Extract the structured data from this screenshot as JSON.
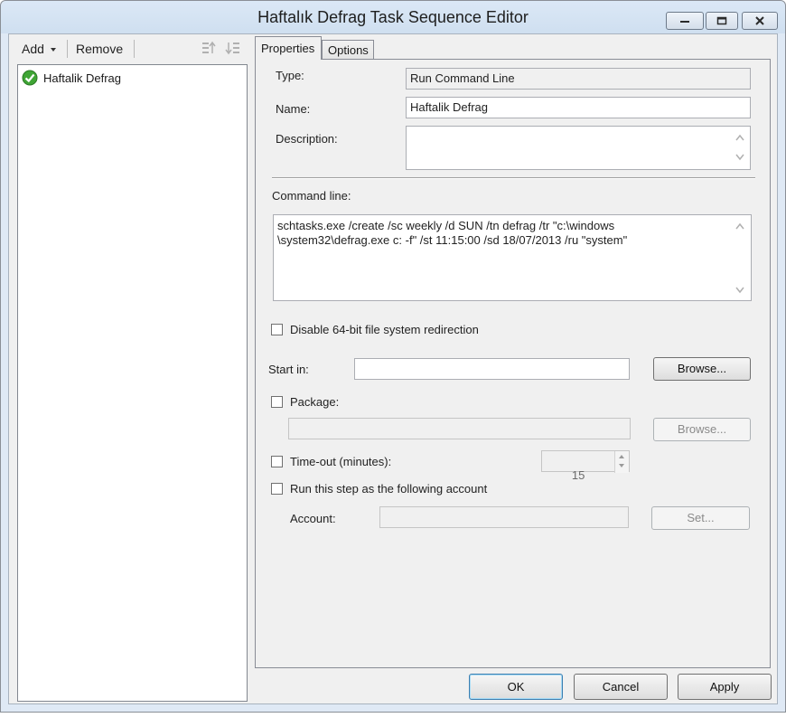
{
  "window": {
    "title": "Haftalık Defrag Task Sequence Editor"
  },
  "toolbar": {
    "add_label": "Add",
    "remove_label": "Remove"
  },
  "tree": {
    "items": [
      {
        "label": "Haftalik Defrag",
        "icon": "green-check-icon"
      }
    ]
  },
  "tabs": [
    {
      "label": "Properties",
      "active": true
    },
    {
      "label": "Options",
      "active": false
    }
  ],
  "properties": {
    "type_label": "Type:",
    "type_value": "Run Command Line",
    "name_label": "Name:",
    "name_value": "Haftalik Defrag",
    "description_label": "Description:",
    "description_value": "",
    "command_line_label": "Command line:",
    "command_line_value": "schtasks.exe /create /sc weekly /d SUN /tn defrag /tr \"c:\\windows\n\\system32\\defrag.exe c: -f\" /st 11:15:00 /sd 18/07/2013 /ru \"system\"",
    "disable_redirection_label": "Disable 64-bit file system redirection",
    "disable_redirection_checked": false,
    "start_in_label": "Start in:",
    "start_in_value": "",
    "browse_label": "Browse...",
    "package_label": "Package:",
    "package_checked": false,
    "package_value": "",
    "package_browse_label": "Browse...",
    "timeout_label": "Time-out (minutes):",
    "timeout_checked": false,
    "timeout_value": "15",
    "run_as_label": "Run this step as the following account",
    "run_as_checked": false,
    "account_label": "Account:",
    "account_value": "",
    "set_label": "Set..."
  },
  "footer": {
    "ok_label": "OK",
    "cancel_label": "Cancel",
    "apply_label": "Apply"
  },
  "colors": {
    "title_bar": "#d3e2f3",
    "window_bg": "#f0f0f0",
    "check_green": "#3fa535",
    "default_button_border": "#3c7fb1"
  }
}
